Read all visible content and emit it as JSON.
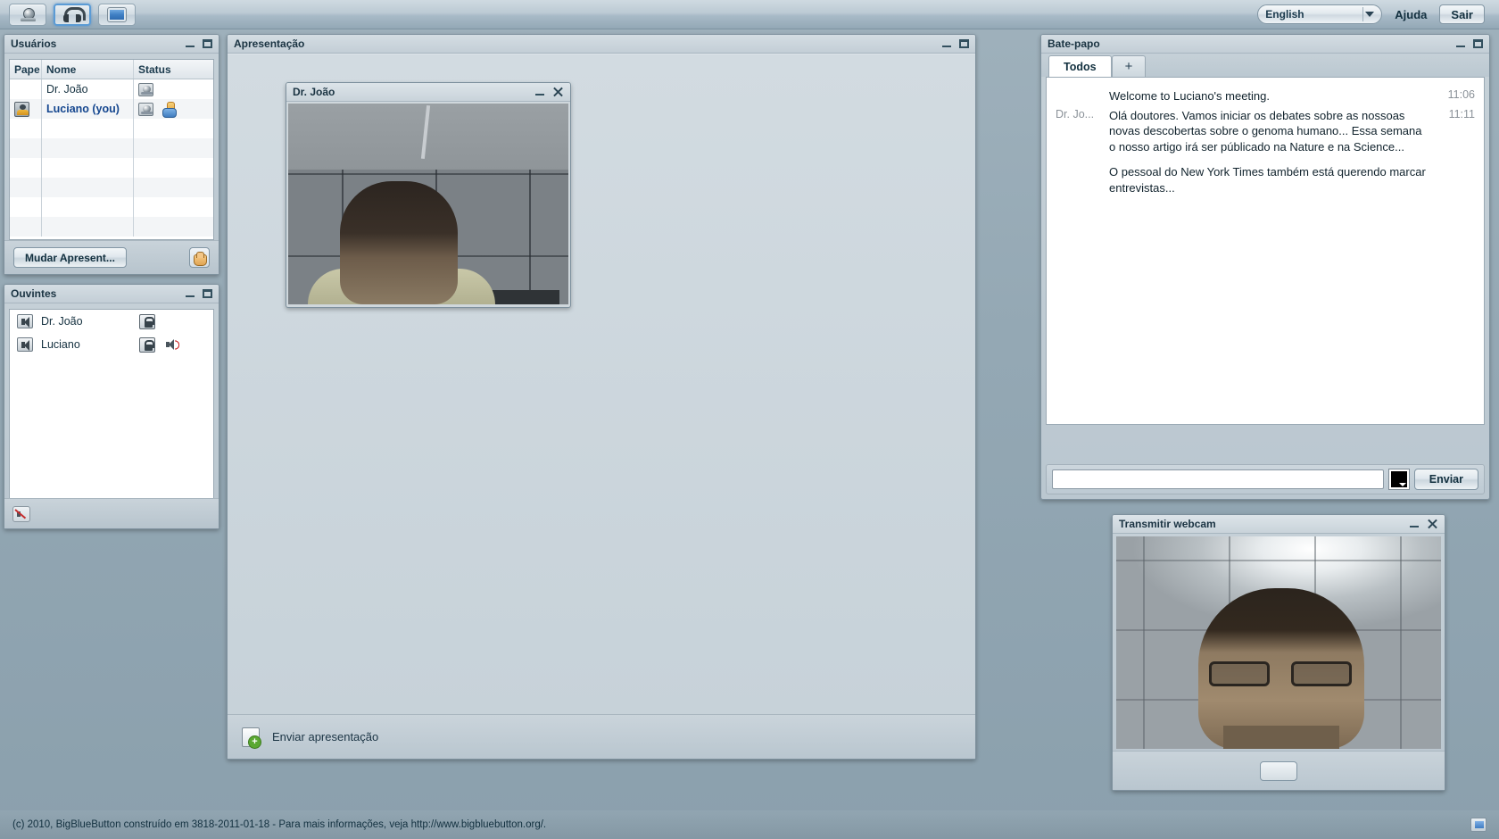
{
  "topbar": {
    "buttons": [
      {
        "name": "webcam-toggle",
        "icon": "webcam-icon",
        "active": false
      },
      {
        "name": "audio-toggle",
        "icon": "headset-icon",
        "active": true
      },
      {
        "name": "desktop-share-toggle",
        "icon": "screen-icon",
        "active": false
      }
    ],
    "language": "English",
    "help_label": "Ajuda",
    "exit_label": "Sair"
  },
  "users_panel": {
    "title": "Usuários",
    "columns": [
      "Pape",
      "Nome",
      "Status"
    ],
    "rows": [
      {
        "role_icon": "",
        "name": "Dr. João",
        "you": false,
        "status_icons": [
          "webcam-icon"
        ]
      },
      {
        "role_icon": "presenter-icon",
        "name": "Luciano (you)",
        "you": true,
        "status_icons": [
          "webcam-icon",
          "raise-hand-icon"
        ]
      }
    ],
    "empty_rows": 5,
    "change_presenter_label": "Mudar Apresent...",
    "raise_hand_icon": "hand-icon"
  },
  "listeners_panel": {
    "title": "Ouvintes",
    "rows": [
      {
        "name": "Dr. João",
        "speaker_icon": "speaker-icon",
        "lock_icon": "lock-icon",
        "talking": false
      },
      {
        "name": "Luciano",
        "speaker_icon": "speaker-icon",
        "lock_icon": "lock-icon",
        "talking": true
      }
    ],
    "mute_all_icon": "mute-all-icon"
  },
  "presentation_panel": {
    "title": "Apresentação",
    "upload_label": "Enviar apresentação",
    "upload_icon": "upload-document-icon"
  },
  "cam_joao": {
    "title": "Dr. João"
  },
  "chat_panel": {
    "title": "Bate-papo",
    "tabs": [
      {
        "label": "Todos",
        "selected": true
      },
      {
        "label": "+",
        "selected": false
      }
    ],
    "messages": [
      {
        "sender": "",
        "text": "Welcome to Luciano's meeting.",
        "time": "11:06"
      },
      {
        "sender": "Dr. Jo...",
        "text": "Olá doutores. Vamos iniciar os debates sobre as nossoas novas descobertas sobre o genoma humano... Essa semana o nosso artigo irá ser públicado na Nature e na Science...",
        "time": "11:11"
      },
      {
        "sender": "",
        "text": "O pessoal do New York Times também está querendo marcar entrevistas...",
        "time": ""
      }
    ],
    "input_value": "",
    "input_placeholder": "",
    "color_swatch": "#000000",
    "send_label": "Enviar"
  },
  "cam_self": {
    "title": "Transmitir webcam",
    "action_button": ""
  },
  "footer": {
    "text": "(c) 2010, BigBlueButton construído em 3818-2011-01-18 - Para mais informações, veja http://www.bigbluebutton.org/.",
    "icon": "screen-share-icon"
  }
}
